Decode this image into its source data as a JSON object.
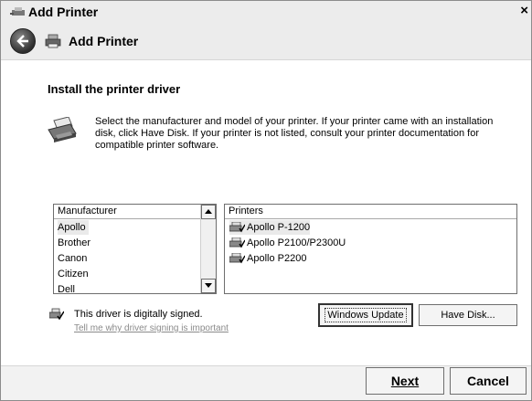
{
  "window": {
    "title": "Add Printer",
    "close_glyph": "×"
  },
  "header": {
    "title": "Add Printer",
    "back_icon": "back-arrow-icon",
    "printer_icon": "printer-icon"
  },
  "content": {
    "section_title": "Install the printer driver",
    "description": "Select the manufacturer and model of your printer. If your printer came with an installation disk, click Have Disk. If your printer is not listed, consult your printer documentation for compatible printer software.",
    "manufacturer_list": {
      "header": "Manufacturer",
      "items": [
        "Apollo",
        "Brother",
        "Canon",
        "Citizen",
        "Dell"
      ],
      "selected": "Apollo"
    },
    "printers_list": {
      "header": "Printers",
      "items": [
        "Apollo P-1200",
        "Apollo P2100/P2300U",
        "Apollo P2200"
      ],
      "selected": "Apollo P-1200"
    },
    "signature_status": "This driver is digitally signed.",
    "signature_link": "Tell me why driver signing is important",
    "windows_update_button": "Windows Update",
    "have_disk_button": "Have Disk..."
  },
  "footer": {
    "next_button": "Next",
    "cancel_button": "Cancel"
  }
}
